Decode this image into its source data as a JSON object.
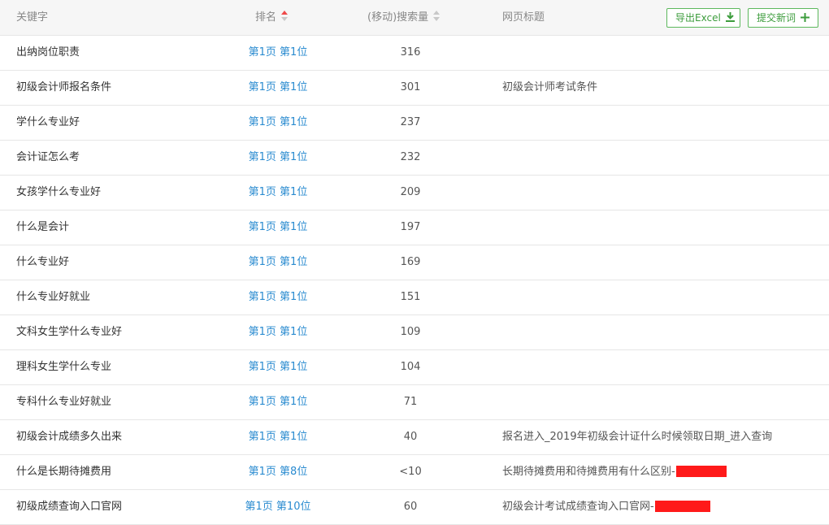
{
  "header": {
    "keyword": "关键字",
    "rank": "排名",
    "volume": "(移动)搜索量",
    "title": "网页标题",
    "export_label": "导出Excel",
    "submit_label": "提交新词"
  },
  "colors": {
    "link": "#2a8bd0",
    "button_green": "#3c9c3c",
    "sort_active": "#ef4a4a",
    "redaction": "#ff1a1a"
  },
  "rows": [
    {
      "keyword": "出纳岗位职责",
      "rank": "第1页 第1位",
      "volume": "316",
      "title": ""
    },
    {
      "keyword": "初级会计师报名条件",
      "rank": "第1页 第1位",
      "volume": "301",
      "title": "初级会计师考试条件"
    },
    {
      "keyword": "学什么专业好",
      "rank": "第1页 第1位",
      "volume": "237",
      "title": ""
    },
    {
      "keyword": "会计证怎么考",
      "rank": "第1页 第1位",
      "volume": "232",
      "title": ""
    },
    {
      "keyword": "女孩学什么专业好",
      "rank": "第1页 第1位",
      "volume": "209",
      "title": ""
    },
    {
      "keyword": "什么是会计",
      "rank": "第1页 第1位",
      "volume": "197",
      "title": ""
    },
    {
      "keyword": "什么专业好",
      "rank": "第1页 第1位",
      "volume": "169",
      "title": ""
    },
    {
      "keyword": "什么专业好就业",
      "rank": "第1页 第1位",
      "volume": "151",
      "title": ""
    },
    {
      "keyword": "文科女生学什么专业好",
      "rank": "第1页 第1位",
      "volume": "109",
      "title": ""
    },
    {
      "keyword": "理科女生学什么专业",
      "rank": "第1页 第1位",
      "volume": "104",
      "title": ""
    },
    {
      "keyword": "专科什么专业好就业",
      "rank": "第1页 第1位",
      "volume": "71",
      "title": ""
    },
    {
      "keyword": "初级会计成绩多久出来",
      "rank": "第1页 第1位",
      "volume": "40",
      "title": "报名进入_2019年初级会计证什么时候领取日期_进入查询"
    },
    {
      "keyword": "什么是长期待摊费用",
      "rank": "第1页 第8位",
      "volume": "<10",
      "title": "长期待摊费用和待摊费用有什么区别-"
    },
    {
      "keyword": "初级成绩查询入口官网",
      "rank": "第1页 第10位",
      "volume": "60",
      "title": "初级会计考试成绩查询入口官网-"
    }
  ]
}
